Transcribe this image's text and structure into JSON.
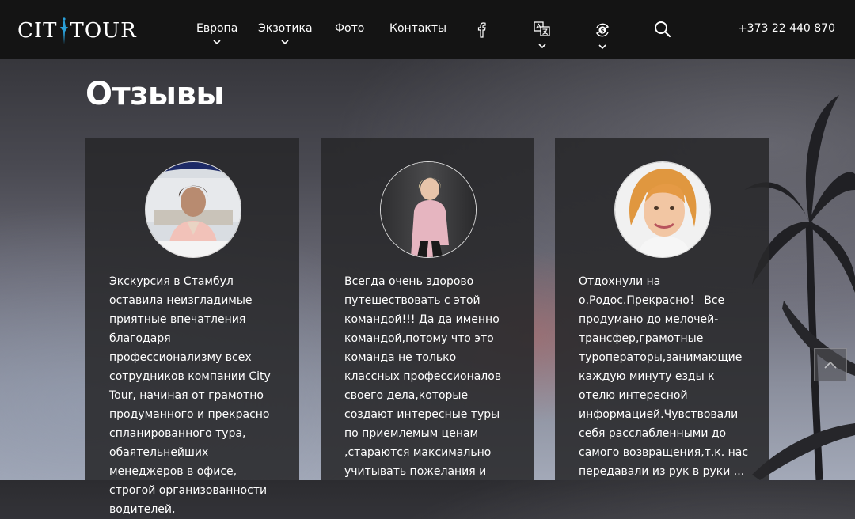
{
  "header": {
    "logo_left": "CIT",
    "logo_right": "TOUR",
    "nav": [
      {
        "label": "Европа"
      },
      {
        "label": "Экзотика"
      },
      {
        "label": "Фото"
      },
      {
        "label": "Контакты"
      }
    ],
    "phone": "+373 22 440 870"
  },
  "page": {
    "title": "Отзывы"
  },
  "reviews": [
    {
      "text": "Экскурсия в Стамбул оставила неизгладимые приятные впечатления благодаря профессионализму всех сотрудников компании City Tour, начиная от грамотно продуманного и прекрасно спланированного тура, обаятельнейших менеджеров в офисе, строгой организованности водителей,"
    },
    {
      "text": "Всегда очень здорово путешествовать с этой командой!!! Да да именно командой,потому что это команда не только классных профессионалов своего дела,которые создают интересные туры по приемлемым ценам ,стараются максимально учитывать пожелания и"
    },
    {
      "text": "Отдохнули на о.Родос.Прекрасно！ Все продумано до мелочей- трансфер,грамотные туроператоры,занимающие каждую минуту езды к отелю интересной информацией.Чувствовали себя расслабленными до самого возвращения,т.к. нас передавали из рук в руки ..."
    }
  ]
}
